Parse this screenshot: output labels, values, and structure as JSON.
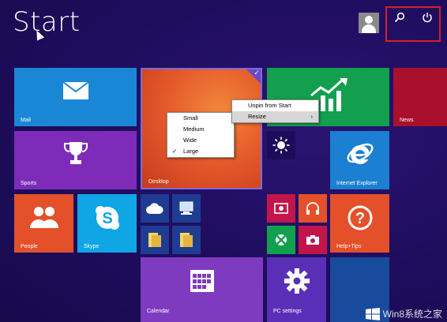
{
  "title": "Start",
  "tiles": {
    "mail": "Mail",
    "desktop": "Desktop",
    "news": "News",
    "sports": "Sports",
    "internet_explorer": "Internet Explorer",
    "people": "People",
    "skype": "Skype",
    "help_tips": "Help+Tips",
    "calendar": "Calendar",
    "pc_settings": "PC settings"
  },
  "context_menu": {
    "unpin": "Unpin from Start",
    "resize": "Resize",
    "arrow": "›"
  },
  "resize_menu": {
    "small": "Small",
    "medium": "Medium",
    "wide": "Wide",
    "large": "Large",
    "checked": "✓"
  },
  "watermark": "Win8系统之家",
  "icons": {
    "search": "search-icon",
    "power": "power-icon"
  },
  "colors": {
    "background": "#1d0c5a",
    "mail": "#1a87d6",
    "desktop": "#e9672a",
    "finance": "#12a04f",
    "news": "#a8102c",
    "sports": "#7d2bb8",
    "ie": "#1b7fd2",
    "people": "#e4502a",
    "skype": "#10a5e4",
    "help": "#e4502a",
    "calendar": "#7e3bbf",
    "pc_settings": "#5a2fb8",
    "highlight_border": "#d71f26"
  }
}
